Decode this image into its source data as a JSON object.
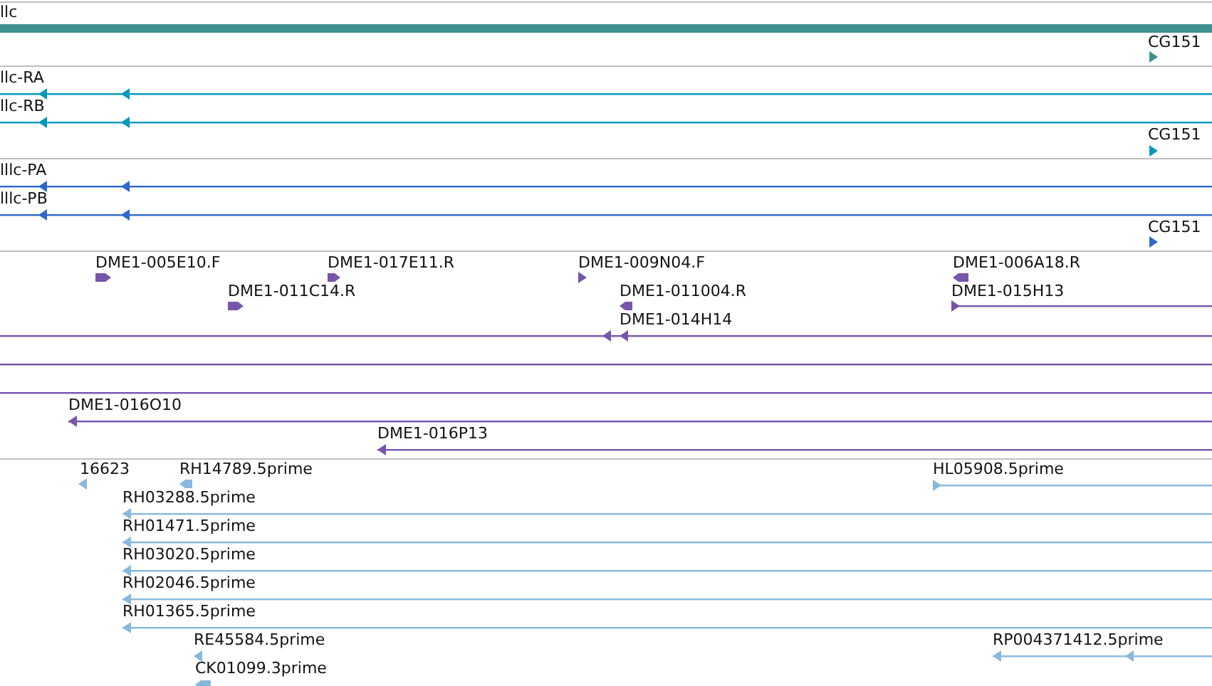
{
  "tracks": [
    {
      "color": "#3f8f8f",
      "features": [
        {
          "label": "llc",
          "kind": "bar"
        },
        {
          "label": "CG151",
          "kind": "tick",
          "reverse": false
        }
      ]
    },
    {
      "color": "#0099bb",
      "features": [
        {
          "label": "llc-RA",
          "kind": "line",
          "reverse": true
        },
        {
          "label": "llc-RB",
          "kind": "line",
          "reverse": true
        },
        {
          "label": "CG151",
          "kind": "tick",
          "reverse": false
        }
      ]
    },
    {
      "color": "#2d68cc",
      "features": [
        {
          "label": "lllc-PA",
          "kind": "line",
          "reverse": true
        },
        {
          "label": "lllc-PB",
          "kind": "line",
          "reverse": true
        },
        {
          "label": "CG151",
          "kind": "tick",
          "reverse": false
        }
      ]
    },
    {
      "color": "#7755aa",
      "features": [
        {
          "label": "DME1-005E10.F",
          "kind": "block",
          "reverse": false
        },
        {
          "label": "DME1-017E11.R",
          "kind": "block",
          "reverse": false
        },
        {
          "label": "DME1-009N04.F",
          "kind": "tick",
          "reverse": false
        },
        {
          "label": "DME1-006A18.R",
          "kind": "block",
          "reverse": true
        },
        {
          "label": "DME1-011C14.R",
          "kind": "block",
          "reverse": false
        },
        {
          "label": "DME1-011004.R",
          "kind": "block",
          "reverse": true
        },
        {
          "label": "DME1-015H13",
          "kind": "line",
          "reverse": false
        },
        {
          "label": "DME1-014H14",
          "kind": "line",
          "reverse": true
        },
        {
          "kind": "line"
        },
        {
          "kind": "line"
        },
        {
          "label": "DME1-016O10",
          "kind": "line",
          "reverse": true
        },
        {
          "label": "DME1-016P13",
          "kind": "line",
          "reverse": true
        }
      ]
    },
    {
      "color": "#88b8dd",
      "features": [
        {
          "label": "16623",
          "kind": "tick",
          "reverse": true
        },
        {
          "label": "RH14789.5prime",
          "kind": "block",
          "reverse": true
        },
        {
          "label": "HL05908.5prime",
          "kind": "line",
          "reverse": false
        },
        {
          "label": "RH03288.5prime",
          "kind": "line",
          "reverse": true
        },
        {
          "label": "RH01471.5prime",
          "kind": "line",
          "reverse": true
        },
        {
          "label": "RH03020.5prime",
          "kind": "line",
          "reverse": true
        },
        {
          "label": "RH02046.5prime",
          "kind": "line",
          "reverse": true
        },
        {
          "label": "RH01365.5prime",
          "kind": "line",
          "reverse": true
        },
        {
          "label": "RE45584.5prime",
          "kind": "tick",
          "reverse": true
        },
        {
          "label": "RP004371412.5prime",
          "kind": "line",
          "reverse": true
        },
        {
          "label": "CK01099.3prime",
          "kind": "block",
          "reverse": true
        }
      ]
    }
  ]
}
